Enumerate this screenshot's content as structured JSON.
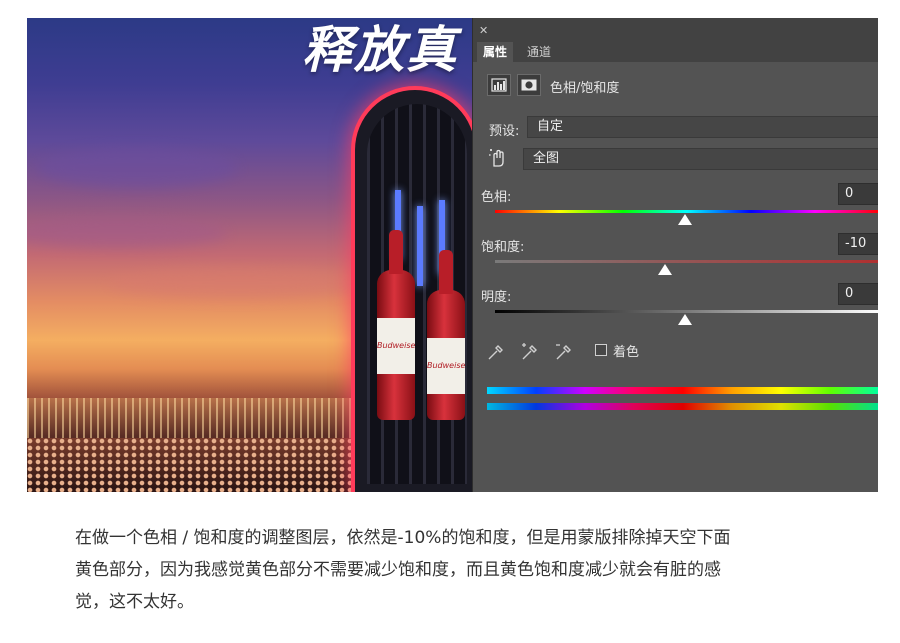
{
  "poster": {
    "headline": "释放真",
    "bottle_label": "Budweiser"
  },
  "panel": {
    "close_glyph": "✕",
    "tabs": [
      {
        "label": "属性",
        "active": true
      },
      {
        "label": "通道",
        "active": false
      }
    ],
    "layer_name": "色相/饱和度",
    "preset": {
      "label": "预设:",
      "value": "自定"
    },
    "range": {
      "value": "全图"
    },
    "hue": {
      "label": "色相:",
      "value": "0"
    },
    "saturation": {
      "label": "饱和度:",
      "value": "-10"
    },
    "lightness": {
      "label": "明度:",
      "value": "0"
    },
    "colorize": {
      "label": "着色",
      "checked": false
    }
  },
  "caption": {
    "line1": "在做一个色相 / 饱和度的调整图层，依然是-10%的饱和度，但是用蒙版排除掉天空下面",
    "line2": "黄色部分，因为我感觉黄色部分不需要减少饱和度，而且黄色饱和度减少就会有脏的感",
    "line3": "觉，这不太好。"
  },
  "colors": {
    "panel_bg": "#535353",
    "panel_tabbar": "#424242",
    "caption_text": "#333333"
  }
}
